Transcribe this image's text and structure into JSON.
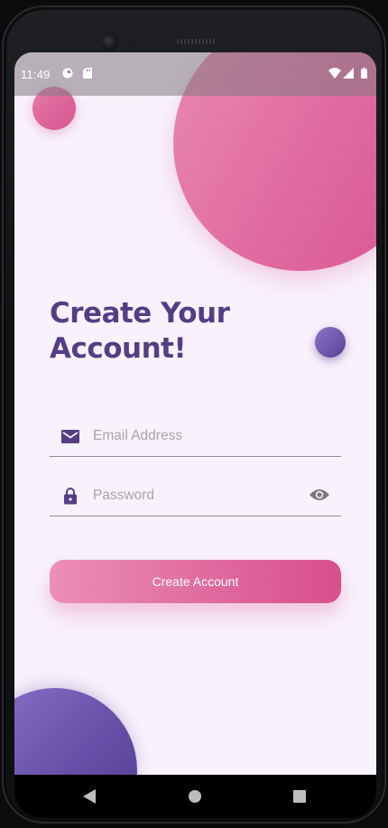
{
  "status_bar": {
    "time": "11:49",
    "icons": [
      "app-notification-icon",
      "sd-card-icon",
      "wifi-icon",
      "cell-signal-icon",
      "battery-icon"
    ]
  },
  "screen": {
    "title": "Create Your Account!",
    "email": {
      "placeholder": "Email Address",
      "value": "",
      "icon": "mail-icon"
    },
    "password": {
      "placeholder": "Password",
      "value": "",
      "icon": "lock-icon",
      "toggle_icon": "eye-icon"
    },
    "submit_label": "Create Account"
  },
  "navigation_bar": {
    "buttons": [
      "back-button",
      "home-button",
      "recents-button"
    ]
  },
  "colors": {
    "background": "#f8f2fc",
    "title": "#553d85",
    "accent_pink": "#e06aa0",
    "accent_purple": "#664fa8",
    "icon": "#553d85",
    "placeholder": "#a9a3ad"
  }
}
